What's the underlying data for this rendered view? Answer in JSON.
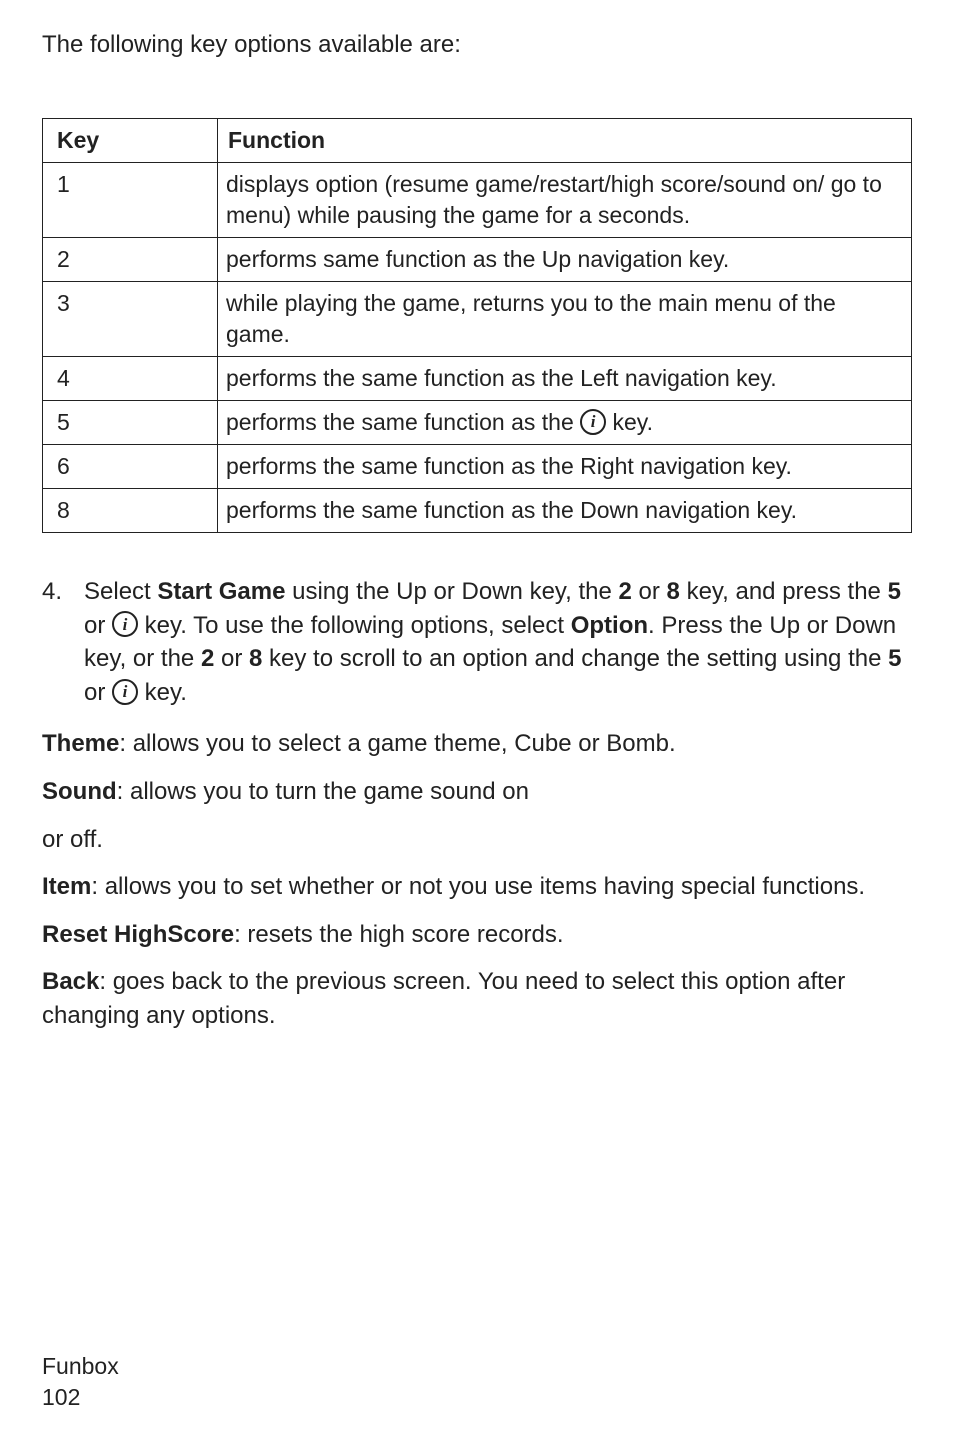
{
  "intro": "The following key options available are:",
  "table": {
    "header": {
      "key": "Key",
      "func": "Function"
    },
    "rows": [
      {
        "key": "1",
        "func": "displays option (resume game/restart/high score/sound on/ go to menu) while pausing the game for a seconds."
      },
      {
        "key": "2",
        "func": "performs same function as the Up navigation key."
      },
      {
        "key": "3",
        "func": "while playing the game, returns you to the main menu of the game."
      },
      {
        "key": "4",
        "func": "performs the same function as the Left navigation key."
      },
      {
        "key": "5",
        "func_before": "performs the same function as the ",
        "func_after": " key."
      },
      {
        "key": "6",
        "func": "performs the same function as the Right navigation key."
      },
      {
        "key": "8",
        "func": "performs the same function as the Down navigation key."
      }
    ]
  },
  "step4": {
    "num": "4.",
    "p1a": "Select ",
    "p1b": "Start Game",
    "p1c": " using the Up or Down key, the ",
    "p1d": "2",
    "p1e": " or ",
    "p1f": "8",
    "p1g": " key, and press the ",
    "p1h": "5",
    "p1i": " or ",
    "p1j": " key. To use the following options, select ",
    "p1k": "Option",
    "p1l": ". Press the Up or Down key, or the ",
    "p1m": "2",
    "p1n": " or ",
    "p1o": "8",
    "p1p": " key to scroll to an option and change the setting using the ",
    "p1q": "5",
    "p1r": " or ",
    "p1s": " key."
  },
  "theme_label": "Theme",
  "theme_text": ": allows you to select a game theme, Cube or Bomb.",
  "sound_label": "Sound",
  "sound_text": ": allows you to turn the game sound on",
  "or_off": "or off.",
  "item_label": "Item",
  "item_text": ": allows you to set whether or not you use items having special functions.",
  "reset_label": "Reset HighScore",
  "reset_text": ": resets the high score records.",
  "back_label": "Back",
  "back_text": ": goes back to the previous screen. You need to select this option after changing any options.",
  "footer_section": "Funbox",
  "footer_page": "102",
  "icon_glyph": "i"
}
